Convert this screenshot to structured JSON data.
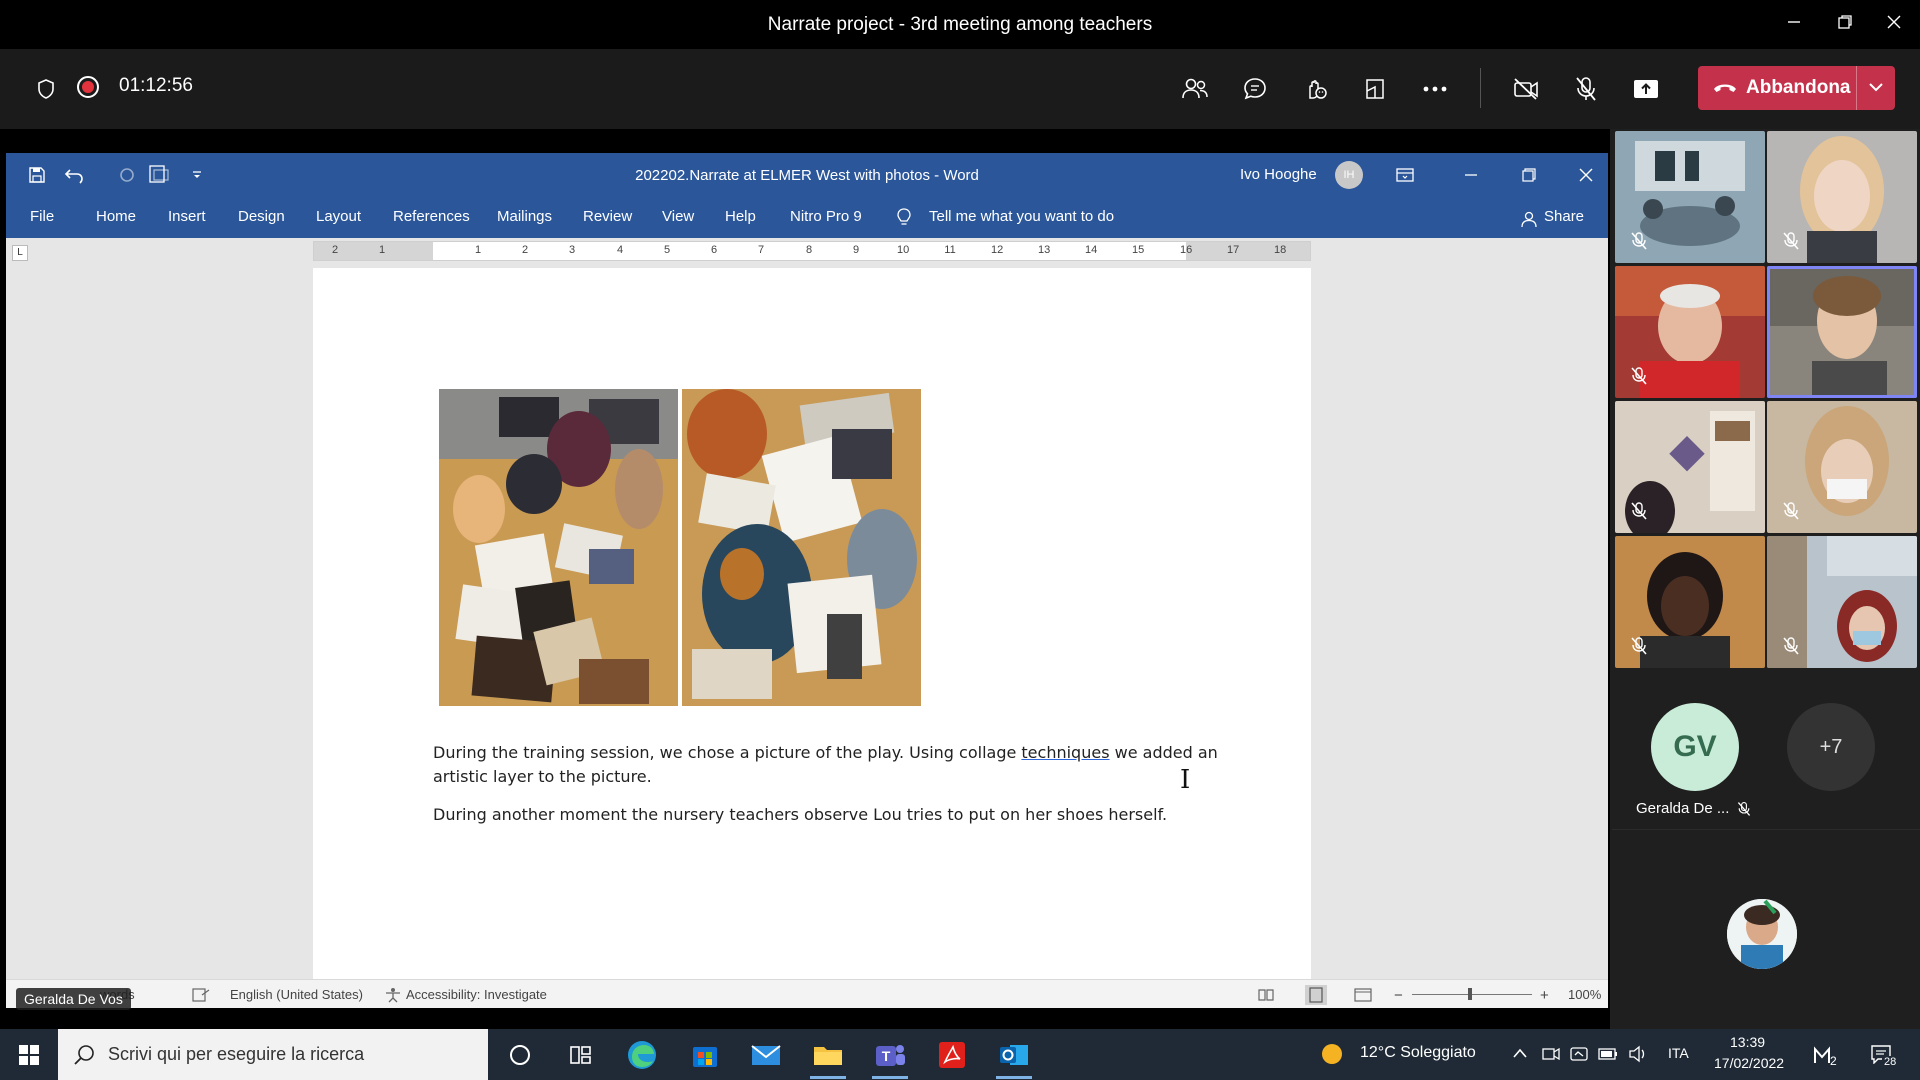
{
  "teams": {
    "title": "Narrate project - 3rd meeting among teachers",
    "timer": "01:12:56",
    "leave_label": "Abbandona",
    "icons": [
      "shield-icon",
      "record-icon",
      "people-icon",
      "chat-icon",
      "reactions-icon",
      "rooms-icon",
      "more-icon",
      "camera-off-icon",
      "mic-off-icon",
      "share-icon"
    ]
  },
  "word": {
    "doc_title": "202202.Narrate at ELMER West with photos  -  Word",
    "user_name": "Ivo Hooghe",
    "user_initials": "IH",
    "menu": {
      "file": "File",
      "home": "Home",
      "insert": "Insert",
      "design": "Design",
      "layout": "Layout",
      "references": "References",
      "mailings": "Mailings",
      "review": "Review",
      "view": "View",
      "help": "Help",
      "nitro": "Nitro Pro 9",
      "tell_me": "Tell me what you want to do",
      "share": "Share"
    },
    "ruler_ticks": [
      "2",
      "1",
      "1",
      "2",
      "3",
      "4",
      "5",
      "6",
      "7",
      "8",
      "9",
      "10",
      "11",
      "12",
      "13",
      "14",
      "15",
      "16",
      "17",
      "18"
    ],
    "para1_a": "During the training session, we chose a picture of the play. Using collage ",
    "para1_spell": "techniques",
    "para1_b": " we added an",
    "para1_line2": "artistic layer to the picture.",
    "para2": "During another moment the nursery teachers observe Lou tries to put on her shoes herself.",
    "status": {
      "words": "words",
      "language": "English (United States)",
      "accessibility": "Accessibility: Investigate",
      "zoom": "100%"
    }
  },
  "presenter_tag": "Geralda De Vos",
  "participants": {
    "gv_initials": "GV",
    "gv_name": "Geralda De ...",
    "more": "+7"
  },
  "taskbar": {
    "search_placeholder": "Scrivi qui per eseguire la ricerca",
    "weather": "12°C  Soleggiato",
    "lang": "ITA",
    "time": "13:39",
    "date": "17/02/2022",
    "notif_count": "28",
    "teams_badge": "2"
  }
}
